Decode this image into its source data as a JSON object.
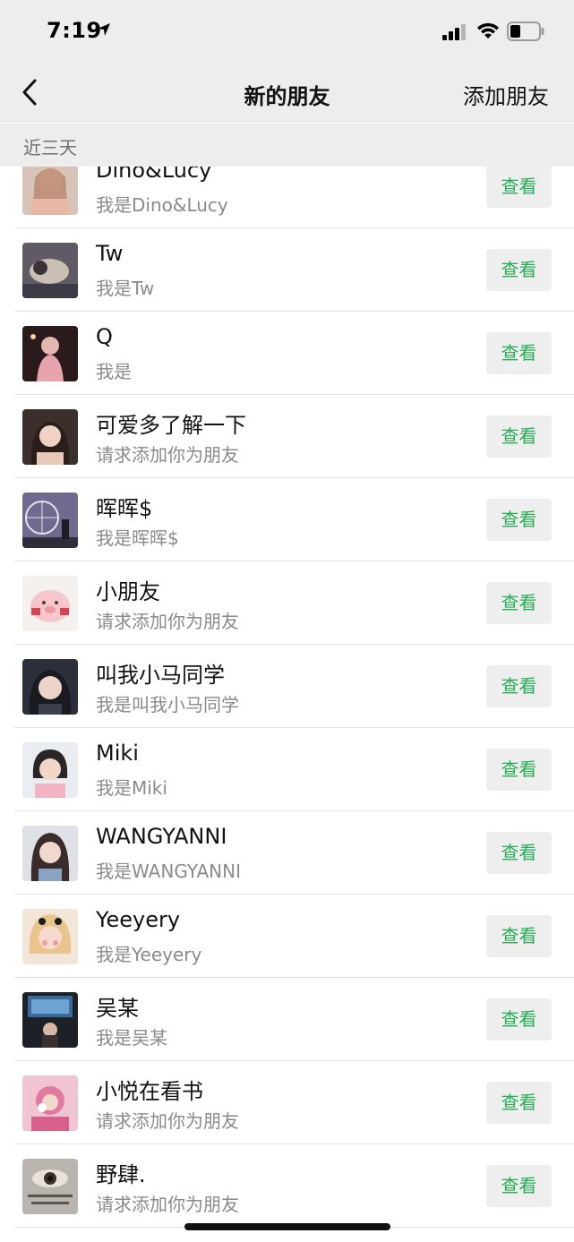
{
  "status_bar": {
    "time": "7:19",
    "icons": [
      "location-arrow-icon",
      "cellular-signal-icon",
      "wifi-icon",
      "battery-icon"
    ]
  },
  "nav": {
    "title": "新的朋友",
    "action": "添加朋友",
    "back_icon": "chevron-left-icon"
  },
  "section": {
    "label": "近三天"
  },
  "colors": {
    "bar_bg": "#ededed",
    "accent_green": "#27ad55",
    "button_bg": "#eeeeee",
    "secondary_text": "#8a8a8a"
  },
  "requests": [
    {
      "name": "Dino&Lucy",
      "message": "我是Dino&Lucy",
      "button": "查看"
    },
    {
      "name": "Tw",
      "message": "我是Tw",
      "button": "查看"
    },
    {
      "name": "Q",
      "message": "我是",
      "button": "查看"
    },
    {
      "name": "可爱多了解一下",
      "message": "请求添加你为朋友",
      "button": "查看"
    },
    {
      "name": "晖晖$",
      "message": "我是晖晖$",
      "button": "查看"
    },
    {
      "name": "小朋友",
      "message": "请求添加你为朋友",
      "button": "查看"
    },
    {
      "name": "叫我小马同学",
      "message": "我是叫我小马同学",
      "button": "查看"
    },
    {
      "name": "Miki",
      "message": "我是Miki",
      "button": "查看"
    },
    {
      "name": "WANGYANNI",
      "message": "我是WANGYANNI",
      "button": "查看"
    },
    {
      "name": "Yeeyery",
      "message": "我是Yeeyery",
      "button": "查看"
    },
    {
      "name": "吴某",
      "message": "我是吴某",
      "button": "查看"
    },
    {
      "name": "小悦在看书",
      "message": "请求添加你为朋友",
      "button": "查看"
    },
    {
      "name": "野肆.",
      "message": "请求添加你为朋友",
      "button": "查看"
    }
  ]
}
